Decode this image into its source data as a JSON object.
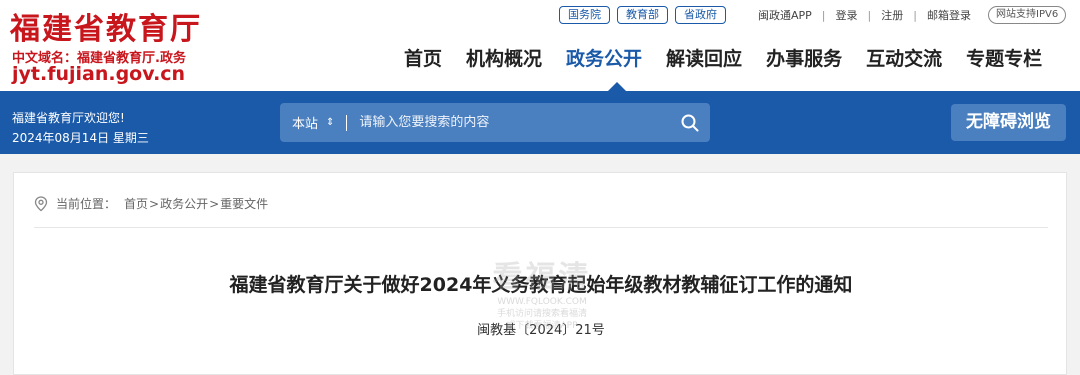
{
  "header": {
    "site_title": "福建省教育厅",
    "domain_cn": "中文域名：福建省教育厅.政务",
    "domain_url": "jyt.fujian.gov.cn",
    "ext_links": [
      "国务院",
      "教育部",
      "省政府"
    ],
    "user_links": [
      "闽政通APP",
      "登录",
      "注册",
      "邮箱登录"
    ],
    "ipv6": "网站支持IPV6"
  },
  "nav": {
    "items": [
      "首页",
      "机构概况",
      "政务公开",
      "解读回应",
      "办事服务",
      "互动交流",
      "专题专栏"
    ],
    "active": "政务公开"
  },
  "bluebar": {
    "welcome": "福建省教育厅欢迎您!",
    "date": "2024年08月14日  星期三",
    "search_scope": "本站",
    "search_placeholder": "请输入您要搜索的内容",
    "accessible": "无障碍浏览"
  },
  "breadcrumb": {
    "label": "当前位置：",
    "items": [
      "首页",
      "政务公开",
      "重要文件"
    ]
  },
  "article": {
    "title": "福建省教育厅关于做好2024年义务教育起始年级教材教辅征订工作的通知",
    "doc_number": "闽教基〔2024〕21号"
  },
  "watermark": {
    "big": "看福清",
    "line1": "WWW.FQLOOK.COM",
    "line2": "手机访问请搜索看福清",
    "line3": "或下载看福清APP"
  },
  "colors": {
    "brand_red": "#c8161d",
    "brand_blue": "#1a5aa8"
  }
}
